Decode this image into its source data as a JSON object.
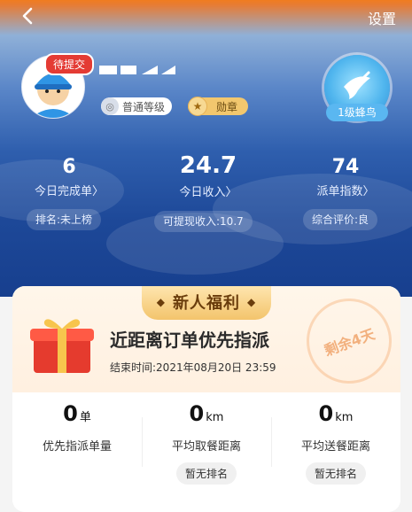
{
  "header": {
    "settings_label": "设置",
    "pending_badge": "待提交",
    "level_label": "普通等级",
    "medal_label": "勋章",
    "bird_level": "1级蜂鸟"
  },
  "stats": [
    {
      "value": "6",
      "label": "今日完成单",
      "sub": "排名:未上榜"
    },
    {
      "value": "24.7",
      "label": "今日收入",
      "sub": "可提现收入:10.7"
    },
    {
      "value": "74",
      "label": "派单指数",
      "sub": "综合评价:良"
    }
  ],
  "promo": {
    "banner": "新人福利",
    "title": "近距离订单优先指派",
    "end_time": "结束时间:2021年08月20日 23:59",
    "stamp": "剩余4天"
  },
  "metrics": [
    {
      "value": "0",
      "unit": "单",
      "label": "优先指派单量",
      "rank": ""
    },
    {
      "value": "0",
      "unit": "km",
      "label": "平均取餐距离",
      "rank": "暂无排名"
    },
    {
      "value": "0",
      "unit": "km",
      "label": "平均送餐距离",
      "rank": "暂无排名"
    }
  ],
  "colors": {
    "header_top": "#f07c1f",
    "header_bottom": "#173f8e",
    "accent_orange": "#f3c46c",
    "pending_red": "#e43b34"
  }
}
